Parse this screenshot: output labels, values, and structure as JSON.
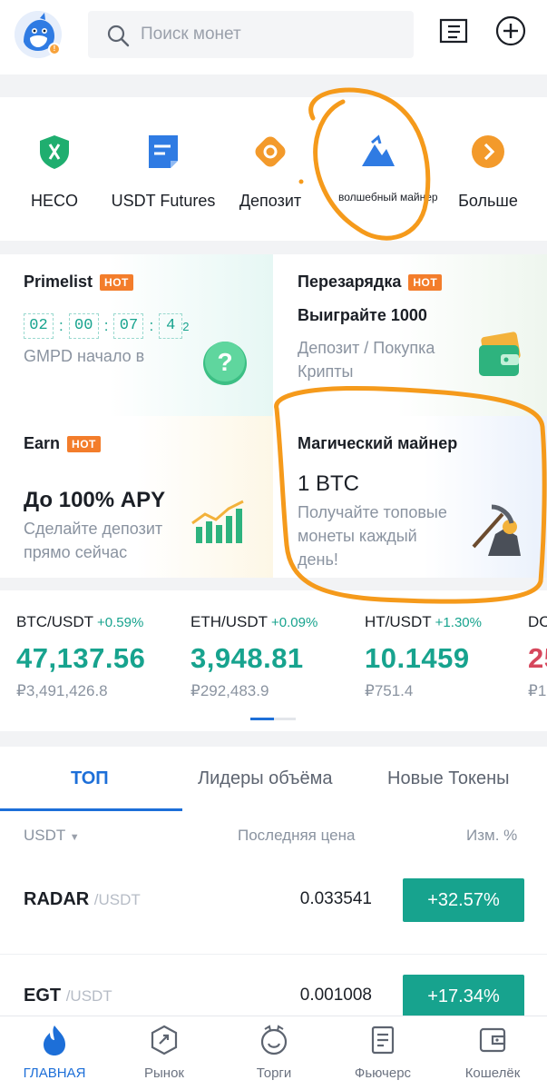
{
  "search": {
    "placeholder": "Поиск монет"
  },
  "shortcuts": [
    {
      "label": "HECO",
      "icon": "heco-icon"
    },
    {
      "label": "USDT Futures",
      "icon": "futures-doc-icon"
    },
    {
      "label": "Депозит",
      "icon": "deposit-icon"
    },
    {
      "label": "волшебный майнер",
      "icon": "mountain-icon"
    },
    {
      "label": "Больше",
      "icon": "more-arrow-icon"
    }
  ],
  "cards": {
    "primelist": {
      "title": "Primelist",
      "hot": "HOT",
      "timer": [
        "02",
        "00",
        "07",
        "4"
      ],
      "timer_tail": "2",
      "subtitle": "GMPD начало в"
    },
    "recharge": {
      "title": "Перезарядка",
      "hot": "HOT",
      "headline": "Выиграйте 1000",
      "subtitle": "Депозит / Покупка Крипты"
    },
    "earn": {
      "title": "Earn",
      "hot": "HOT",
      "headline": "До 100% APY",
      "subtitle": "Сделайте депозит прямо сейчас"
    },
    "miner": {
      "title": "Магический майнер",
      "headline": "1 BTC",
      "subtitle": "Получайте топовые монеты каждый день!"
    }
  },
  "tickers": [
    {
      "pair": "BTC/USDT",
      "change": "+0.59%",
      "price": "47,137.56",
      "fiat": "₽3,491,426.8"
    },
    {
      "pair": "ETH/USDT",
      "change": "+0.09%",
      "price": "3,948.81",
      "fiat": "₽292,483.9"
    },
    {
      "pair": "HT/USDT",
      "change": "+1.30%",
      "price": "10.1459",
      "fiat": "₽751.4"
    },
    {
      "pair": "DC",
      "change": "",
      "price": "25",
      "fiat": "₽1"
    }
  ],
  "market": {
    "tabs": [
      "ТОП",
      "Лидеры объёма",
      "Новые Токены"
    ],
    "quote_selector": "USDT",
    "col_last_price": "Последняя цена",
    "col_change": "Изм. %",
    "rows": [
      {
        "symbol": "RADAR",
        "quote": "/USDT",
        "price": "0.033541",
        "change": "+32.57%"
      },
      {
        "symbol": "EGT",
        "quote": "/USDT",
        "price": "0.001008",
        "change": "+17.34%"
      }
    ]
  },
  "nav": [
    {
      "label": "ГЛАВНАЯ",
      "icon": "home-flame-icon"
    },
    {
      "label": "Рынок",
      "icon": "market-icon"
    },
    {
      "label": "Торги",
      "icon": "trade-icon"
    },
    {
      "label": "Фьючерс",
      "icon": "futures-icon"
    },
    {
      "label": "Кошелёк",
      "icon": "wallet-icon"
    }
  ],
  "colors": {
    "accent_blue": "#1d6fd8",
    "green": "#17a38e",
    "red": "#d6475c",
    "hot_orange": "#f37d2b",
    "annotation_orange": "#f59a1b"
  }
}
